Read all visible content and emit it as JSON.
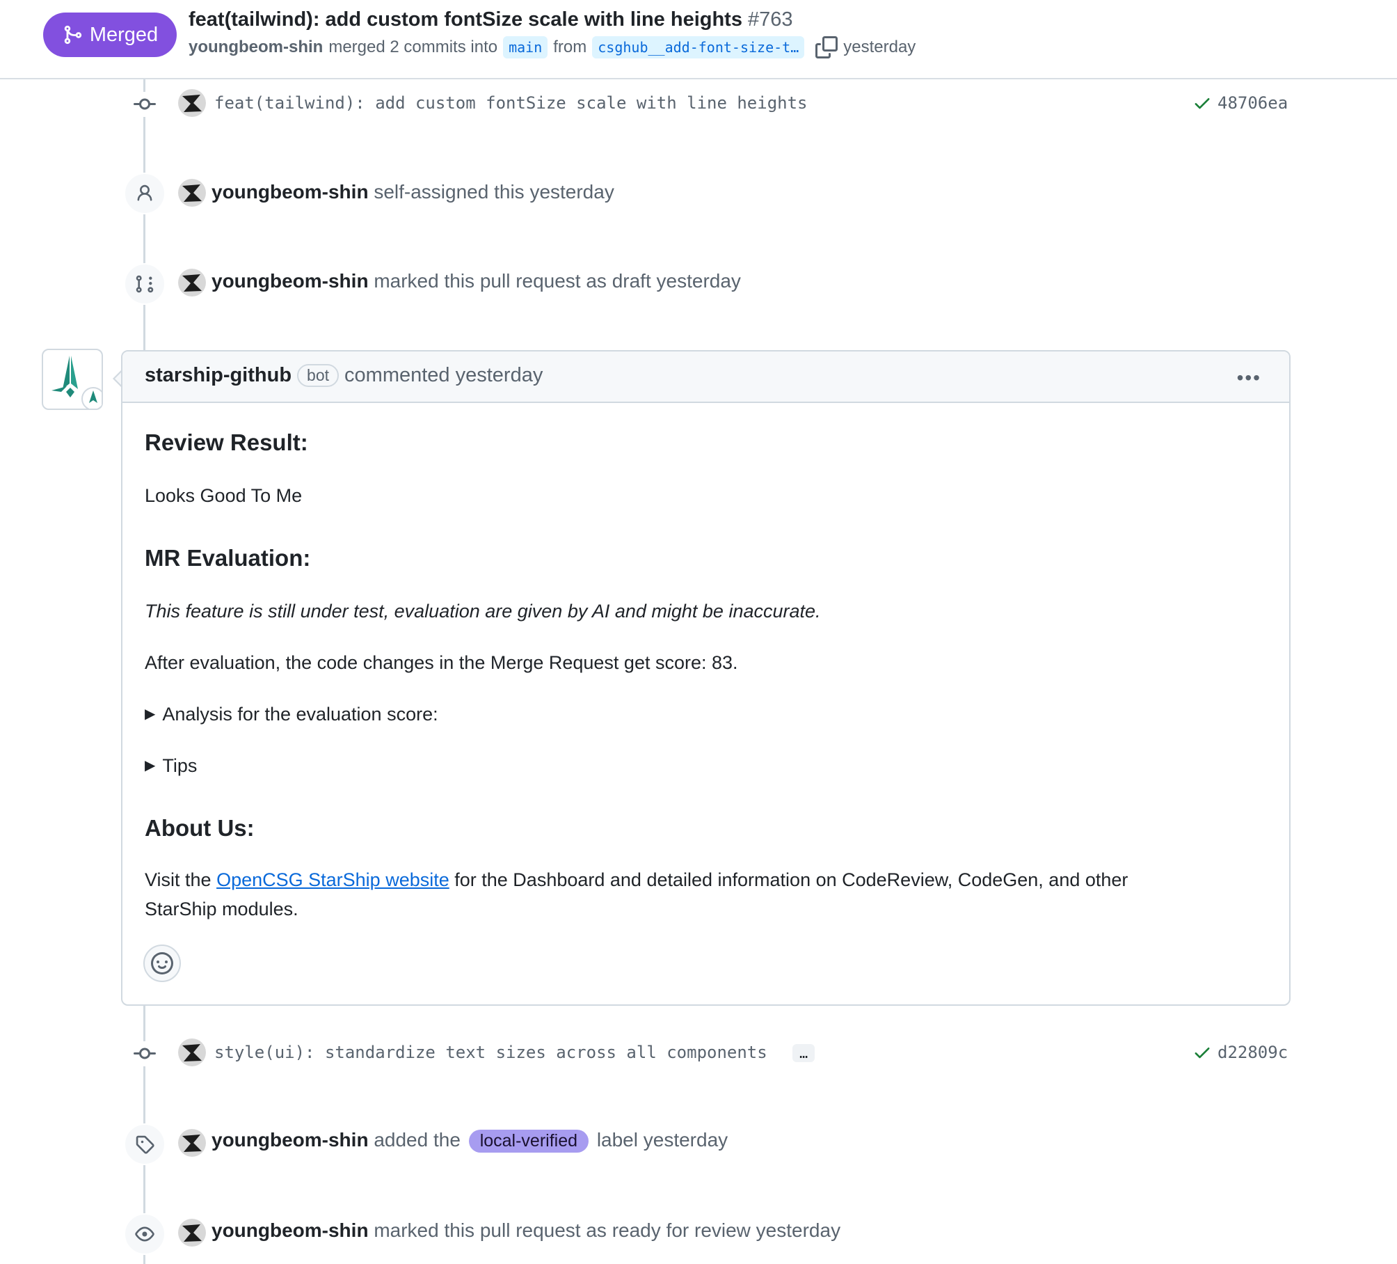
{
  "header": {
    "status_label": "Merged",
    "title": "feat(tailwind): add custom fontSize scale with line heights",
    "number": "#763",
    "author": "youngbeom-shin",
    "merged_text": "merged 2 commits into",
    "base_branch": "main",
    "from_text": "from",
    "head_branch": "csghub__add-font-size-t…",
    "time": "yesterday"
  },
  "timeline": {
    "commit1": {
      "message": "feat(tailwind): add custom fontSize scale with line heights",
      "sha": "48706ea"
    },
    "assign": {
      "user": "youngbeom-shin",
      "text": "self-assigned this yesterday"
    },
    "draft": {
      "user": "youngbeom-shin",
      "text": "marked this pull request as draft yesterday"
    },
    "comment": {
      "author": "starship-github",
      "bot_tag": "bot",
      "action": "commented yesterday",
      "menu": "•••",
      "h_review": "Review Result:",
      "review_text": "Looks Good To Me",
      "h_eval": "MR Evaluation:",
      "eval_note": "This feature is still under test, evaluation are given by AI and might be inaccurate.",
      "eval_score": "After evaluation, the code changes in the Merge Request get score: 83.",
      "details_analysis": "Analysis for the evaluation score:",
      "details_tips": "Tips",
      "h_about": "About Us:",
      "about_prefix": "Visit the",
      "about_link": "OpenCSG StarShip website",
      "about_suffix": "for the Dashboard and detailed information on CodeReview, CodeGen, and other",
      "about_line2": "StarShip modules."
    },
    "commit2": {
      "message": "style(ui): standardize text sizes across all components",
      "ellipsis": "…",
      "sha": "d22809c"
    },
    "label_event": {
      "user": "youngbeom-shin",
      "prefix": "added the",
      "label": "local-verified",
      "suffix": "label yesterday"
    },
    "ready": {
      "user": "youngbeom-shin",
      "text": "marked this pull request as ready for review yesterday"
    }
  },
  "colors": {
    "merged": "#8250df",
    "link": "#0969da",
    "success": "#1a7f37",
    "label": "#a79cf0"
  },
  "icons": [
    "git-merge-icon",
    "copy-icon",
    "git-commit-icon",
    "person-icon",
    "git-pull-request-draft-icon",
    "check-icon",
    "kebab-horizontal-icon",
    "smiley-icon",
    "tag-icon",
    "eye-icon"
  ]
}
